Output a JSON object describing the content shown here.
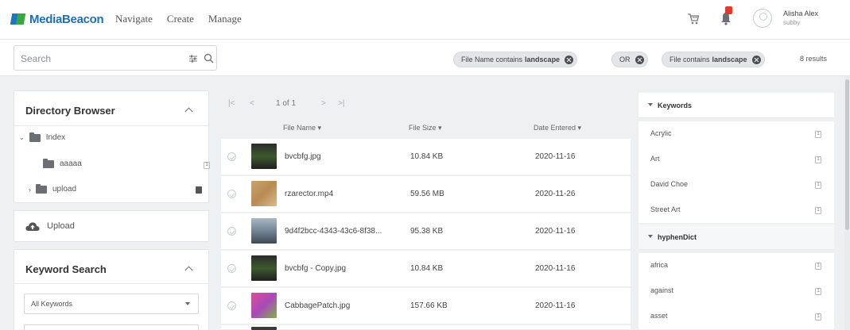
{
  "header": {
    "logo_text": "MediaBeacon",
    "nav": [
      "Navigate",
      "Create",
      "Manage"
    ],
    "user_name": "Alisha Alex",
    "user_sub": "subby",
    "notification_count": "1"
  },
  "search": {
    "placeholder": "Search",
    "chips": [
      {
        "prefix": "File Name contains",
        "term": "landscape"
      },
      {
        "prefix": "OR",
        "term": ""
      },
      {
        "prefix": "File contains",
        "term": "landscape"
      }
    ],
    "results": "8 results"
  },
  "directory": {
    "title": "Directory Browser",
    "items": [
      {
        "label": "Index"
      },
      {
        "label": "aaaaa"
      },
      {
        "label": "upload"
      }
    ]
  },
  "upload": {
    "label": "Upload"
  },
  "keyword_search": {
    "title": "Keyword Search",
    "select_value": "All Keywords"
  },
  "pager": {
    "text": "1 of 1"
  },
  "table": {
    "headers": [
      "File Name ▾",
      "File Size ▾",
      "Date Entered ▾"
    ],
    "rows": [
      {
        "name": "bvcbfg.jpg",
        "size": "10.84 KB",
        "date": "2020-11-16"
      },
      {
        "name": "rzarector.mp4",
        "size": "59.56 MB",
        "date": "2020-11-26"
      },
      {
        "name": "9d4f2bcc-4343-43c6-8f38...",
        "size": "95.38 KB",
        "date": "2020-11-16"
      },
      {
        "name": "bvcbfg - Copy.jpg",
        "size": "10.84 KB",
        "date": "2020-11-16"
      },
      {
        "name": "CabbagePatch.jpg",
        "size": "157.66 KB",
        "date": "2020-11-16"
      }
    ]
  },
  "facets": {
    "keywords_title": "Keywords",
    "keywords": [
      "Acrylic",
      "Art",
      "David Choe",
      "Street Art"
    ],
    "hyphen_title": "hyphenDict",
    "hyphen": [
      "africa",
      "against",
      "asset"
    ]
  },
  "colors": {
    "brand_blue": "#1d6fb8",
    "brand_green": "#3aa640",
    "badge_red": "#e03a2f"
  }
}
